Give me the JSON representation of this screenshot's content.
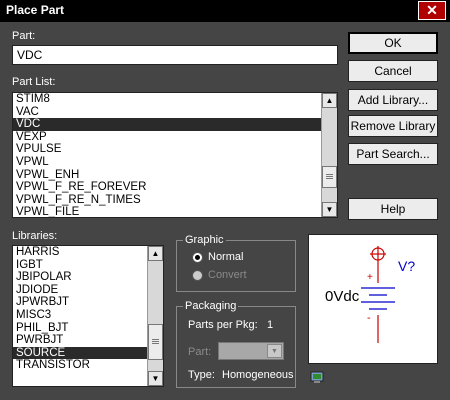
{
  "window": {
    "title": "Place Part"
  },
  "part": {
    "label": "Part:",
    "value": "VDC"
  },
  "part_list": {
    "label": "Part List:",
    "items": [
      "STIM8",
      "VAC",
      "VDC",
      "VEXP",
      "VPULSE",
      "VPWL",
      "VPWL_ENH",
      "VPWL_F_RE_FOREVER",
      "VPWL_F_RE_N_TIMES",
      "VPWL_FILE"
    ],
    "selected": "VDC"
  },
  "libraries": {
    "label": "Libraries:",
    "items": [
      "HARRIS",
      "IGBT",
      "JBIPOLAR",
      "JDIODE",
      "JPWRBJT",
      "MISC3",
      "PHIL_BJT",
      "PWRBJT",
      "SOURCE",
      "TRANSISTOR"
    ],
    "selected": "SOURCE"
  },
  "buttons": {
    "ok": "OK",
    "cancel": "Cancel",
    "add_library": "Add Library...",
    "remove_library": "Remove Library",
    "part_search": "Part Search...",
    "help": "Help"
  },
  "graphic": {
    "title": "Graphic",
    "normal": "Normal",
    "convert": "Convert",
    "selected": "Normal"
  },
  "packaging": {
    "title": "Packaging",
    "parts_per_pkg_label": "Parts per Pkg:",
    "parts_per_pkg_value": "1",
    "part_label": "Part:",
    "type_label": "Type:",
    "type_value": "Homogeneous"
  },
  "preview": {
    "value_text": "0Vdc",
    "ref_text": "V?",
    "plus": "+",
    "minus": "-"
  },
  "colors": {
    "title_bg": "#000000",
    "dialog_bg": "#454545",
    "selection": "#2a2a2a",
    "symbol_red": "#cc0000",
    "symbol_blue": "#0000cc"
  }
}
